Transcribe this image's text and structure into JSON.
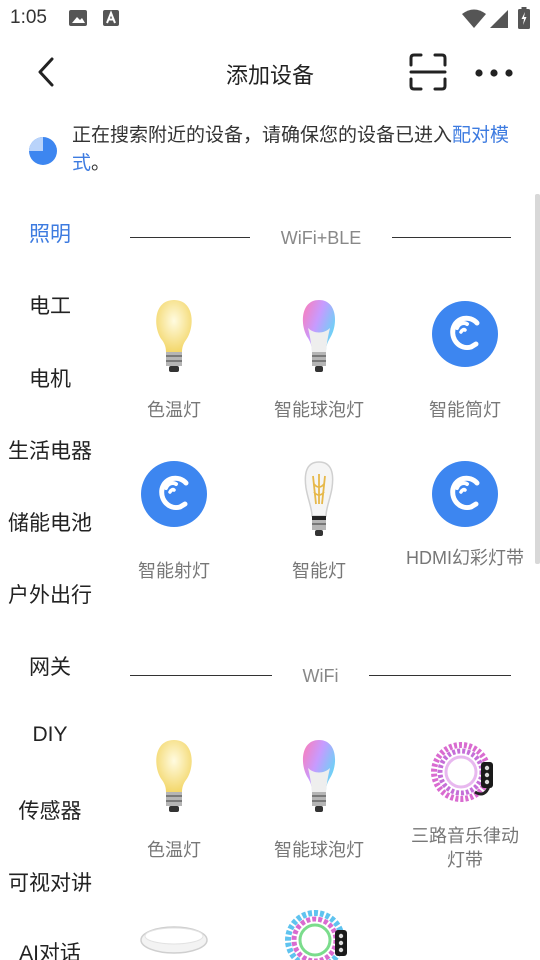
{
  "status_bar": {
    "time": "1:05",
    "icons": [
      "image-icon",
      "font-icon",
      "wifi-icon",
      "signal-icon",
      "battery-icon"
    ]
  },
  "header": {
    "title": "添加设备",
    "icons": [
      "back-arrow-icon",
      "scan-icon",
      "more-icon"
    ]
  },
  "notice": {
    "text": "正在搜索附近的设备，请确保您的设备已进入",
    "link": "配对模式",
    "suffix": "。"
  },
  "categories": [
    {
      "label": "照明",
      "active": true
    },
    {
      "label": "电工",
      "active": false
    },
    {
      "label": "电机",
      "active": false
    },
    {
      "label": "生活电器",
      "active": false
    },
    {
      "label": "储能电池",
      "active": false
    },
    {
      "label": "户外出行",
      "active": false
    },
    {
      "label": "网关",
      "active": false
    },
    {
      "label": "DIY",
      "active": false
    },
    {
      "label": "传感器",
      "active": false
    },
    {
      "label": "可视对讲",
      "active": false
    },
    {
      "label": "AI对话",
      "active": false
    }
  ],
  "sections": [
    {
      "title": "WiFi+BLE",
      "devices": [
        {
          "label": "色温灯",
          "icon": "warm-bulb-icon"
        },
        {
          "label": "智能球泡灯",
          "icon": "rgb-bulb-icon"
        },
        {
          "label": "智能筒灯",
          "icon": "brand-logo-icon"
        },
        {
          "label": "智能射灯",
          "icon": "brand-logo-icon"
        },
        {
          "label": "智能灯",
          "icon": "filament-bulb-icon"
        },
        {
          "label": "HDMI幻彩灯带",
          "icon": "brand-logo-icon"
        }
      ]
    },
    {
      "title": "WiFi",
      "devices": [
        {
          "label": "色温灯",
          "icon": "warm-bulb-icon"
        },
        {
          "label": "智能球泡灯",
          "icon": "rgb-bulb-icon"
        },
        {
          "label": "三路音乐律动灯带",
          "icon": "light-strip-icon"
        },
        {
          "label": "",
          "icon": "ceiling-light-icon"
        },
        {
          "label": "",
          "icon": "light-strip-icon"
        }
      ]
    }
  ],
  "colors": {
    "accent": "#3d7be0",
    "brand_circle": "#3d86f0",
    "text_muted": "#777777"
  }
}
